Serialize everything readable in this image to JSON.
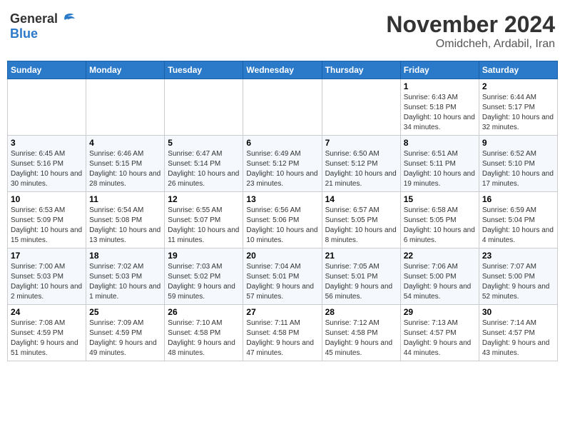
{
  "header": {
    "logo_general": "General",
    "logo_blue": "Blue",
    "month": "November 2024",
    "location": "Omidcheh, Ardabil, Iran"
  },
  "days_of_week": [
    "Sunday",
    "Monday",
    "Tuesday",
    "Wednesday",
    "Thursday",
    "Friday",
    "Saturday"
  ],
  "weeks": [
    [
      {
        "day": "",
        "info": ""
      },
      {
        "day": "",
        "info": ""
      },
      {
        "day": "",
        "info": ""
      },
      {
        "day": "",
        "info": ""
      },
      {
        "day": "",
        "info": ""
      },
      {
        "day": "1",
        "info": "Sunrise: 6:43 AM\nSunset: 5:18 PM\nDaylight: 10 hours and 34 minutes."
      },
      {
        "day": "2",
        "info": "Sunrise: 6:44 AM\nSunset: 5:17 PM\nDaylight: 10 hours and 32 minutes."
      }
    ],
    [
      {
        "day": "3",
        "info": "Sunrise: 6:45 AM\nSunset: 5:16 PM\nDaylight: 10 hours and 30 minutes."
      },
      {
        "day": "4",
        "info": "Sunrise: 6:46 AM\nSunset: 5:15 PM\nDaylight: 10 hours and 28 minutes."
      },
      {
        "day": "5",
        "info": "Sunrise: 6:47 AM\nSunset: 5:14 PM\nDaylight: 10 hours and 26 minutes."
      },
      {
        "day": "6",
        "info": "Sunrise: 6:49 AM\nSunset: 5:12 PM\nDaylight: 10 hours and 23 minutes."
      },
      {
        "day": "7",
        "info": "Sunrise: 6:50 AM\nSunset: 5:12 PM\nDaylight: 10 hours and 21 minutes."
      },
      {
        "day": "8",
        "info": "Sunrise: 6:51 AM\nSunset: 5:11 PM\nDaylight: 10 hours and 19 minutes."
      },
      {
        "day": "9",
        "info": "Sunrise: 6:52 AM\nSunset: 5:10 PM\nDaylight: 10 hours and 17 minutes."
      }
    ],
    [
      {
        "day": "10",
        "info": "Sunrise: 6:53 AM\nSunset: 5:09 PM\nDaylight: 10 hours and 15 minutes."
      },
      {
        "day": "11",
        "info": "Sunrise: 6:54 AM\nSunset: 5:08 PM\nDaylight: 10 hours and 13 minutes."
      },
      {
        "day": "12",
        "info": "Sunrise: 6:55 AM\nSunset: 5:07 PM\nDaylight: 10 hours and 11 minutes."
      },
      {
        "day": "13",
        "info": "Sunrise: 6:56 AM\nSunset: 5:06 PM\nDaylight: 10 hours and 10 minutes."
      },
      {
        "day": "14",
        "info": "Sunrise: 6:57 AM\nSunset: 5:05 PM\nDaylight: 10 hours and 8 minutes."
      },
      {
        "day": "15",
        "info": "Sunrise: 6:58 AM\nSunset: 5:05 PM\nDaylight: 10 hours and 6 minutes."
      },
      {
        "day": "16",
        "info": "Sunrise: 6:59 AM\nSunset: 5:04 PM\nDaylight: 10 hours and 4 minutes."
      }
    ],
    [
      {
        "day": "17",
        "info": "Sunrise: 7:00 AM\nSunset: 5:03 PM\nDaylight: 10 hours and 2 minutes."
      },
      {
        "day": "18",
        "info": "Sunrise: 7:02 AM\nSunset: 5:03 PM\nDaylight: 10 hours and 1 minute."
      },
      {
        "day": "19",
        "info": "Sunrise: 7:03 AM\nSunset: 5:02 PM\nDaylight: 9 hours and 59 minutes."
      },
      {
        "day": "20",
        "info": "Sunrise: 7:04 AM\nSunset: 5:01 PM\nDaylight: 9 hours and 57 minutes."
      },
      {
        "day": "21",
        "info": "Sunrise: 7:05 AM\nSunset: 5:01 PM\nDaylight: 9 hours and 56 minutes."
      },
      {
        "day": "22",
        "info": "Sunrise: 7:06 AM\nSunset: 5:00 PM\nDaylight: 9 hours and 54 minutes."
      },
      {
        "day": "23",
        "info": "Sunrise: 7:07 AM\nSunset: 5:00 PM\nDaylight: 9 hours and 52 minutes."
      }
    ],
    [
      {
        "day": "24",
        "info": "Sunrise: 7:08 AM\nSunset: 4:59 PM\nDaylight: 9 hours and 51 minutes."
      },
      {
        "day": "25",
        "info": "Sunrise: 7:09 AM\nSunset: 4:59 PM\nDaylight: 9 hours and 49 minutes."
      },
      {
        "day": "26",
        "info": "Sunrise: 7:10 AM\nSunset: 4:58 PM\nDaylight: 9 hours and 48 minutes."
      },
      {
        "day": "27",
        "info": "Sunrise: 7:11 AM\nSunset: 4:58 PM\nDaylight: 9 hours and 47 minutes."
      },
      {
        "day": "28",
        "info": "Sunrise: 7:12 AM\nSunset: 4:58 PM\nDaylight: 9 hours and 45 minutes."
      },
      {
        "day": "29",
        "info": "Sunrise: 7:13 AM\nSunset: 4:57 PM\nDaylight: 9 hours and 44 minutes."
      },
      {
        "day": "30",
        "info": "Sunrise: 7:14 AM\nSunset: 4:57 PM\nDaylight: 9 hours and 43 minutes."
      }
    ]
  ]
}
